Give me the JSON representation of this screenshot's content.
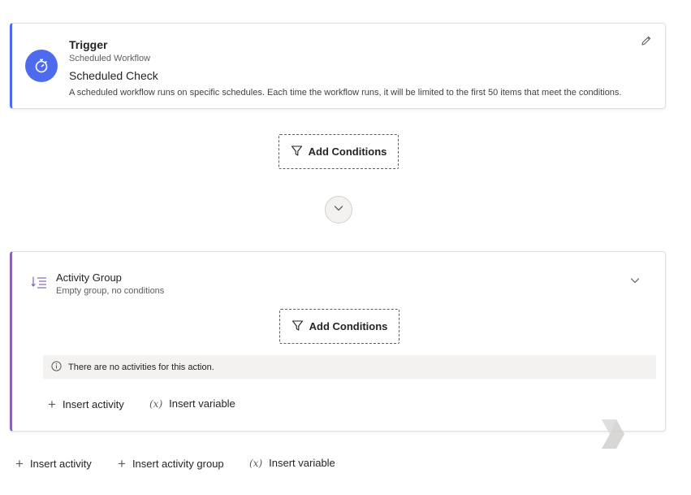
{
  "trigger": {
    "title": "Trigger",
    "subtitle": "Scheduled Workflow",
    "name": "Scheduled Check",
    "description": "A scheduled workflow runs on specific schedules. Each time the workflow runs, it will be limited to the first 50 items that meet the conditions.",
    "icon": "stopwatch-icon",
    "accent": "#4f6bed"
  },
  "add_conditions_label": "Add Conditions",
  "group": {
    "title": "Activity Group",
    "subtitle": "Empty group, no conditions",
    "accent": "#8764b8",
    "info": "There are no activities for this action.",
    "insert_activity": "Insert activity",
    "insert_variable": "Insert variable"
  },
  "bottom_actions": {
    "insert_activity": "Insert activity",
    "insert_activity_group": "Insert activity group",
    "insert_variable": "Insert variable"
  },
  "icons": {
    "edit": "pencil-icon",
    "delete": "trash-icon",
    "collapse": "chevron-down-icon",
    "filter": "filter-icon",
    "info": "info-icon",
    "plus": "plus-icon",
    "variable": "fx-icon"
  }
}
